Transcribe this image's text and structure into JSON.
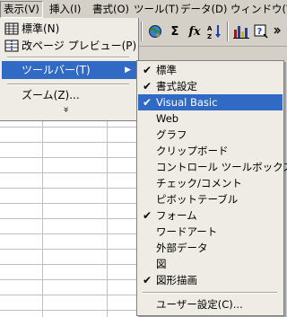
{
  "menubar": {
    "items": [
      {
        "label": "表示(V)"
      },
      {
        "label": "挿入(I)"
      },
      {
        "label": "書式(O)"
      },
      {
        "label": "ツール(T)"
      },
      {
        "label": "データ(D)"
      },
      {
        "label": "ウィンドウ(W)"
      }
    ]
  },
  "view_menu": {
    "items": [
      {
        "label": "標準(N)",
        "icon": "normal-view-icon"
      },
      {
        "label": "改ページ プレビュー(P)",
        "icon": "page-break-preview-icon"
      },
      {
        "label": "ツールバー(T)",
        "has_submenu": true,
        "selected": true
      },
      {
        "label": "ズーム(Z)..."
      }
    ],
    "expand_glyph": "»"
  },
  "toolbar": {
    "buttons": [
      "globe-icon",
      "autosum-icon",
      "function-icon",
      "sort-ascending-icon",
      "chart-wizard-icon",
      "help-icon"
    ],
    "sigma": "Σ",
    "fx": "fx"
  },
  "toolbars_submenu": {
    "items": [
      {
        "label": "標準",
        "checked": true
      },
      {
        "label": "書式設定",
        "checked": true
      },
      {
        "label": "Visual Basic",
        "checked": true,
        "selected": true
      },
      {
        "label": "Web",
        "checked": false
      },
      {
        "label": "グラフ",
        "checked": false
      },
      {
        "label": "クリップボード",
        "checked": false
      },
      {
        "label": "コントロール ツールボックス",
        "checked": false
      },
      {
        "label": "チェック/コメント",
        "checked": false
      },
      {
        "label": "ピボットテーブル",
        "checked": false
      },
      {
        "label": "フォーム",
        "checked": true
      },
      {
        "label": "ワードアート",
        "checked": false
      },
      {
        "label": "外部データ",
        "checked": false
      },
      {
        "label": "図",
        "checked": false
      },
      {
        "label": "図形描画",
        "checked": true
      },
      {
        "label": "ユーザー設定(C)...",
        "checked": false
      }
    ]
  },
  "colors": {
    "highlight": "#316ac5",
    "menu_bg": "#efece5",
    "chrome": "#d4d0c8"
  }
}
